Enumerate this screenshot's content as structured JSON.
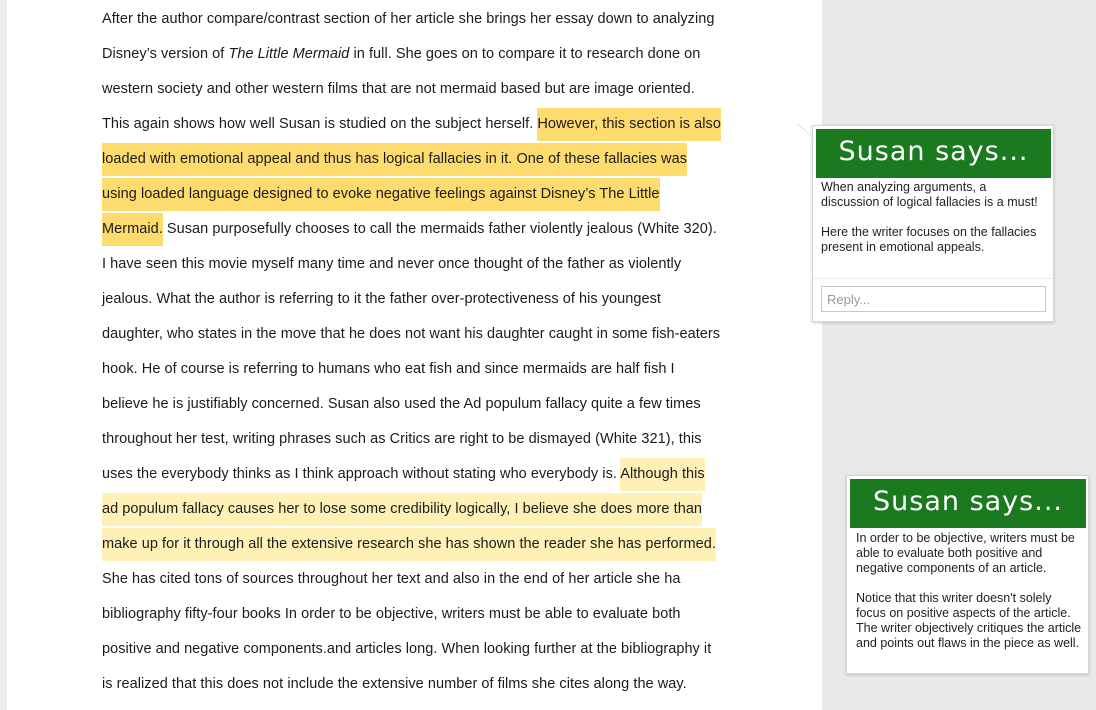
{
  "document": {
    "lines": [
      [
        {
          "t": "After the author compare/contrast section of her article she brings her essay down to analyzing"
        }
      ],
      [
        {
          "t": "Disney’s version of "
        },
        {
          "t": "The Little Mermaid",
          "em": true
        },
        {
          "t": " in full. She goes on to compare it to research done on"
        }
      ],
      [
        {
          "t": "western society and other western films that are not mermaid based but are image oriented."
        }
      ],
      [
        {
          "t": "This again shows how well Susan is studied on the subject herself. "
        },
        {
          "t": "However, this section is also",
          "hl": "hl1"
        }
      ],
      [
        {
          "t": "loaded with emotional appeal and thus has logical fallacies in it. One of these fallacies was",
          "hl": "hl1"
        }
      ],
      [
        {
          "t": "using loaded language designed to evoke negative feelings against Disney’s The Little",
          "hl": "hl1"
        }
      ],
      [
        {
          "t": "Mermaid.",
          "hl": "hl1"
        },
        {
          "t": " Susan purposefully chooses to call the mermaids father violently jealous (White 320)."
        }
      ],
      [
        {
          "t": "I have seen this movie myself many time and never once thought of the father as violently"
        }
      ],
      [
        {
          "t": "jealous. What the author is referring to it the father over-protectiveness of his youngest"
        }
      ],
      [
        {
          "t": "daughter, who states in the move that he does not want his daughter caught in some fish-eaters"
        }
      ],
      [
        {
          "t": "hook. He of course is referring to humans who eat fish and since mermaids are half fish I"
        }
      ],
      [
        {
          "t": "believe he is justifiably concerned. Susan also used the Ad populum fallacy quite a few times"
        }
      ],
      [
        {
          "t": "throughout her test, writing phrases such as Critics are right to be dismayed (White 321), this"
        }
      ],
      [
        {
          "t": "uses the everybody thinks as I think approach without stating who everybody is. "
        },
        {
          "t": "Although this",
          "hl": "hl2"
        }
      ],
      [
        {
          "t": "ad populum fallacy causes her to lose some credibility logically, I believe she does more than",
          "hl": "hl2"
        }
      ],
      [
        {
          "t": "make up for it through all the extensive research she has shown the reader she has performed.",
          "hl": "hl2"
        }
      ],
      [
        {
          "t": "She has cited tons of sources throughout her text and also in the end of her article she ha"
        }
      ],
      [
        {
          "t": "bibliography fifty-four books In order to be objective, writers must be able to evaluate both"
        }
      ],
      [
        {
          "t": "positive and negative components.and articles long. When looking further at the bibliography it"
        }
      ],
      [
        {
          "t": "is realized that this does not include the extensive number of films she cites along the way."
        }
      ]
    ]
  },
  "comments": [
    {
      "banner": "Susan says...",
      "paragraphs": [
        "When analyzing arguments, a discussion of logical fallacies is a must!",
        "Here the writer focuses on the fallacies present in emotional appeals."
      ],
      "reply_placeholder": "Reply..."
    },
    {
      "banner": "Susan says...",
      "paragraphs": [
        "In order to be objective, writers must be able to evaluate both positive and negative components of an article.",
        "Notice that this writer doesn't solely focus on positive aspects of the article. The writer objectively critiques the article and points out flaws in the piece as well."
      ]
    }
  ],
  "colors": {
    "highlight_strong": "#fedb6e",
    "highlight_light": "#fff0b6",
    "banner_green": "#1b7a1f"
  }
}
